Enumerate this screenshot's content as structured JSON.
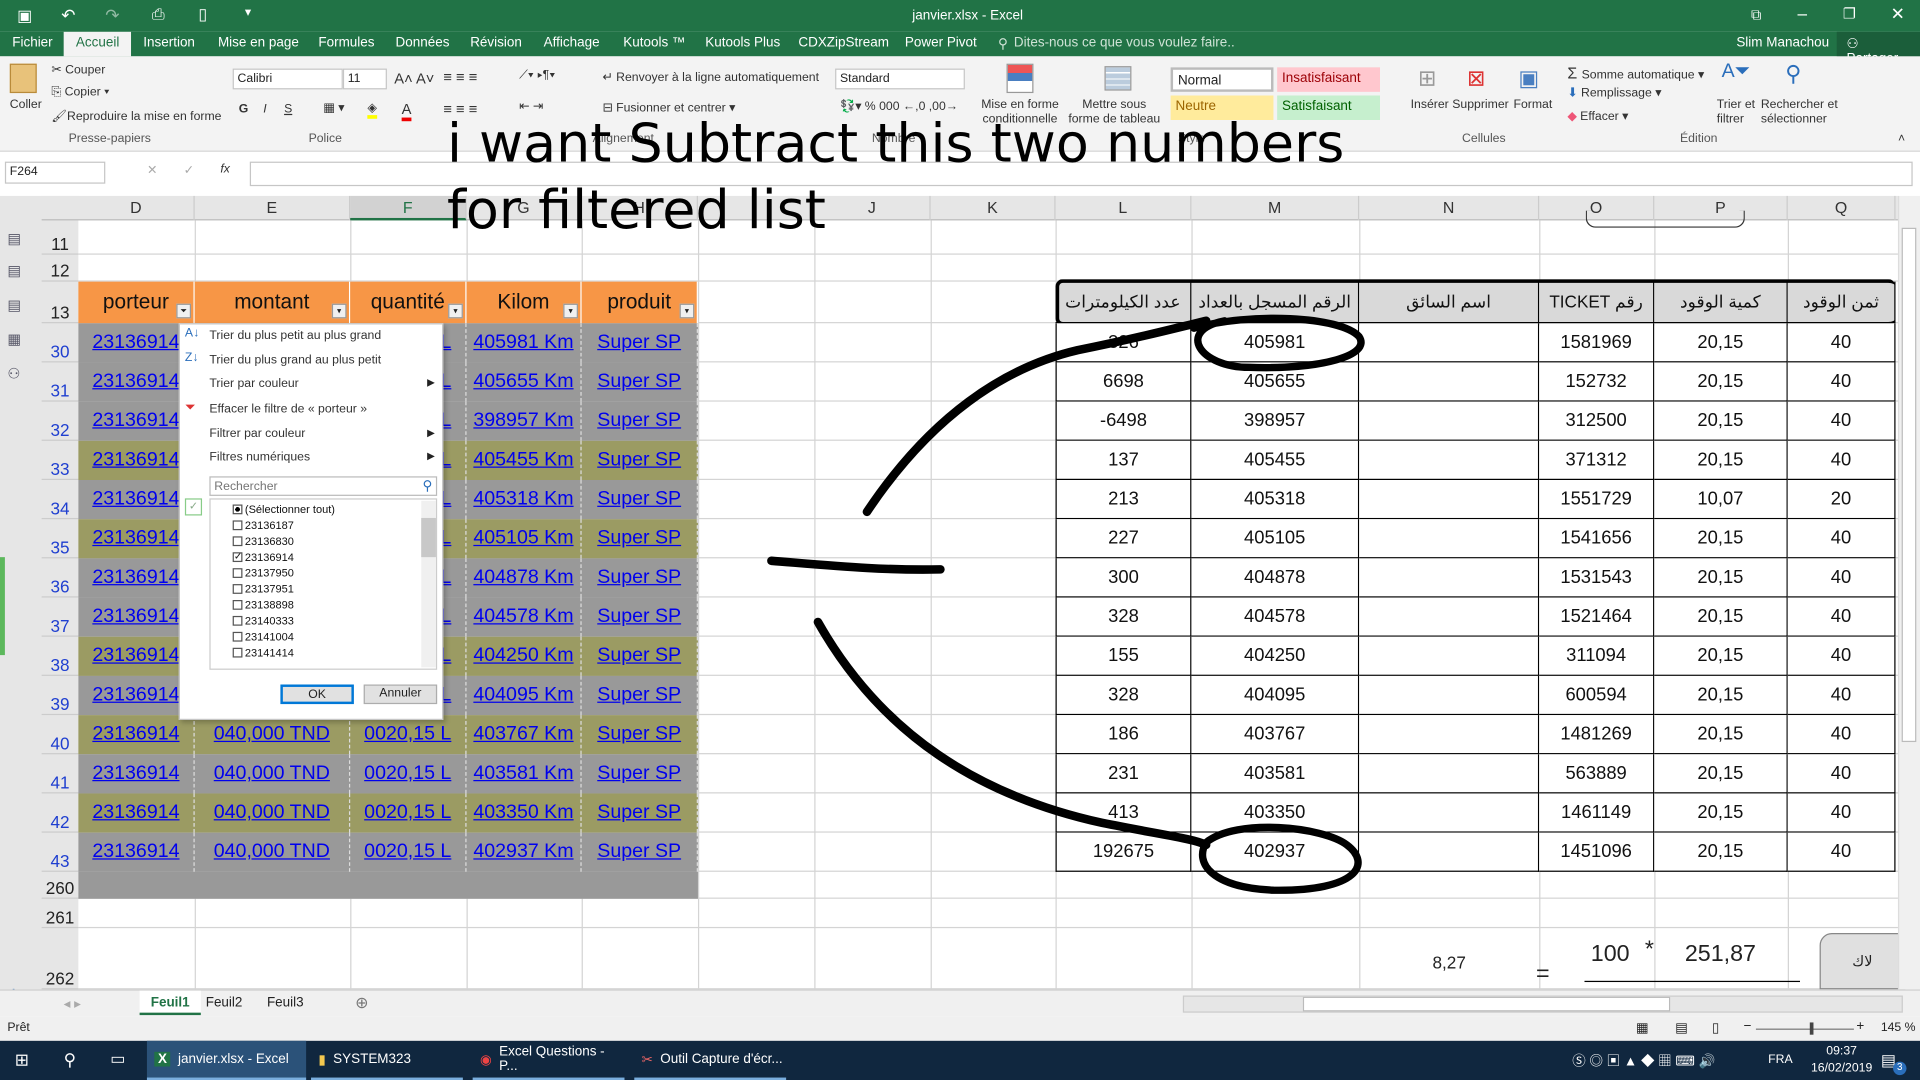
{
  "window": {
    "title": "janvier.xlsx - Excel",
    "user": "Slim Manachou",
    "share": "Partager"
  },
  "tabs": [
    "Fichier",
    "Accueil",
    "Insertion",
    "Mise en page",
    "Formules",
    "Données",
    "Révision",
    "Affichage",
    "Kutools ™",
    "Kutools Plus",
    "CDXZipStream",
    "Power Pivot"
  ],
  "tell_me": "Dites-nous ce que vous voulez faire..",
  "ribbon": {
    "paste": "Coller",
    "cut": "Couper",
    "copy": "Copier",
    "format_painter": "Reproduire la mise en forme",
    "clipboard": "Presse-papiers",
    "font": "Calibri",
    "font_size": "11",
    "bold": "G",
    "italic": "I",
    "underline": "S",
    "police": "Police",
    "wrap": "Renvoyer à la ligne automatiquement",
    "merge": "Fusionner et centrer",
    "alignment": "Alignement",
    "number_format": "Standard",
    "number": "Nombre",
    "cond_format": "Mise en forme conditionnelle",
    "as_table": "Mettre sous forme de tableau",
    "styles": [
      "Normal",
      "Insatisfaisant",
      "Neutre",
      "Satisfaisant"
    ],
    "style": "Style",
    "insert": "Insérer",
    "delete": "Supprimer",
    "format": "Format",
    "cells": "Cellules",
    "autosum": "Somme automatique",
    "fill": "Remplissage",
    "clear": "Effacer",
    "sort_filter": "Trier et filtrer",
    "find_select": "Rechercher et sélectionner",
    "edition": "Édition"
  },
  "formula_bar": {
    "name_box": "F264",
    "fx": "fx",
    "value": ""
  },
  "overlay_text": [
    "i want  Subtract this two numbers",
    "for filtered list"
  ],
  "columns": [
    "D",
    "E",
    "F",
    "G",
    "H",
    "I",
    "J",
    "K",
    "L",
    "M",
    "N",
    "O",
    "P",
    "Q"
  ],
  "row_numbers_top": [
    "11",
    "12",
    "13"
  ],
  "row_numbers_data": [
    "30",
    "31",
    "32",
    "33",
    "34",
    "35",
    "36",
    "37",
    "38",
    "39",
    "40",
    "41",
    "42",
    "43"
  ],
  "row_numbers_bottom": [
    "260",
    "261",
    "262"
  ],
  "left_table": {
    "headers": [
      "porteur",
      "montant",
      "quantité",
      "Kilom",
      "produit"
    ],
    "porteur": "23136914",
    "montant": "040,000 TND",
    "quantite": "0020,15 L",
    "produit": "Super SP",
    "kilom": [
      "405981 Km",
      "405655 Km",
      "398957 Km",
      "405455 Km",
      "405318 Km",
      "405105 Km",
      "404878 Km",
      "404578 Km",
      "404250 Km",
      "404095 Km",
      "403767 Km",
      "403581 Km",
      "403350 Km",
      "402937 Km"
    ]
  },
  "right_table": {
    "headers": [
      "عدد الكيلومترات",
      "الرقم المسجل بالعداد",
      "اسم السائق",
      "رقم TICKET",
      "كمية الوقود",
      "ثمن الوقود"
    ],
    "rows": [
      [
        "326",
        "405981",
        "",
        "1581969",
        "20,15",
        "40"
      ],
      [
        "6698",
        "405655",
        "",
        "152732",
        "20,15",
        "40"
      ],
      [
        "-6498",
        "398957",
        "",
        "312500",
        "20,15",
        "40"
      ],
      [
        "137",
        "405455",
        "",
        "371312",
        "20,15",
        "40"
      ],
      [
        "213",
        "405318",
        "",
        "1551729",
        "10,07",
        "20"
      ],
      [
        "227",
        "405105",
        "",
        "1541656",
        "20,15",
        "40"
      ],
      [
        "300",
        "404878",
        "",
        "1531543",
        "20,15",
        "40"
      ],
      [
        "328",
        "404578",
        "",
        "1521464",
        "20,15",
        "40"
      ],
      [
        "155",
        "404250",
        "",
        "311094",
        "20,15",
        "40"
      ],
      [
        "328",
        "404095",
        "",
        "600594",
        "20,15",
        "40"
      ],
      [
        "186",
        "403767",
        "",
        "1481269",
        "20,15",
        "40"
      ],
      [
        "231",
        "403581",
        "",
        "563889",
        "20,15",
        "40"
      ],
      [
        "413",
        "403350",
        "",
        "1461149",
        "20,15",
        "40"
      ],
      [
        "192675",
        "402937",
        "",
        "1451096",
        "20,15",
        "40"
      ]
    ]
  },
  "bottom_cells": {
    "n262": "8,27",
    "eq": "=",
    "mul_a": "100",
    "mul_sign": "*",
    "mul_b": "251,87",
    "shape": "لاك"
  },
  "filter_menu": {
    "items": [
      "Trier du plus petit au plus grand",
      "Trier du plus grand au plus petit",
      "Trier par couleur",
      "Effacer le filtre de « porteur »",
      "Filtrer par couleur",
      "Filtres numériques"
    ],
    "search_placeholder": "Rechercher",
    "list": [
      {
        "label": "(Sélectionner tout)",
        "state": "partial"
      },
      {
        "label": "23136187",
        "state": "unchecked"
      },
      {
        "label": "23136830",
        "state": "unchecked"
      },
      {
        "label": "23136914",
        "state": "checked"
      },
      {
        "label": "23137950",
        "state": "unchecked"
      },
      {
        "label": "23137951",
        "state": "unchecked"
      },
      {
        "label": "23138898",
        "state": "unchecked"
      },
      {
        "label": "23140333",
        "state": "unchecked"
      },
      {
        "label": "23141004",
        "state": "unchecked"
      },
      {
        "label": "23141414",
        "state": "unchecked"
      }
    ],
    "ok": "OK",
    "cancel": "Annuler"
  },
  "sheets": [
    "Feuil1",
    "Feuil2",
    "Feuil3"
  ],
  "active_sheet": "Feuil1",
  "status": {
    "ready": "Prêt",
    "zoom": "145 %"
  },
  "taskbar": {
    "items": [
      "janvier.xlsx - Excel",
      "SYSTEM323",
      "Excel Questions - P...",
      "Outil Capture d'écr..."
    ],
    "lang": "FRA",
    "time": "09:37",
    "date": "16/02/2019",
    "notif": "3"
  },
  "colors": {
    "excel_green": "#217346",
    "header_orange": "#f79646",
    "row_gray": "#999999",
    "row_olive": "#9b9b63",
    "link": "#0000ee"
  }
}
